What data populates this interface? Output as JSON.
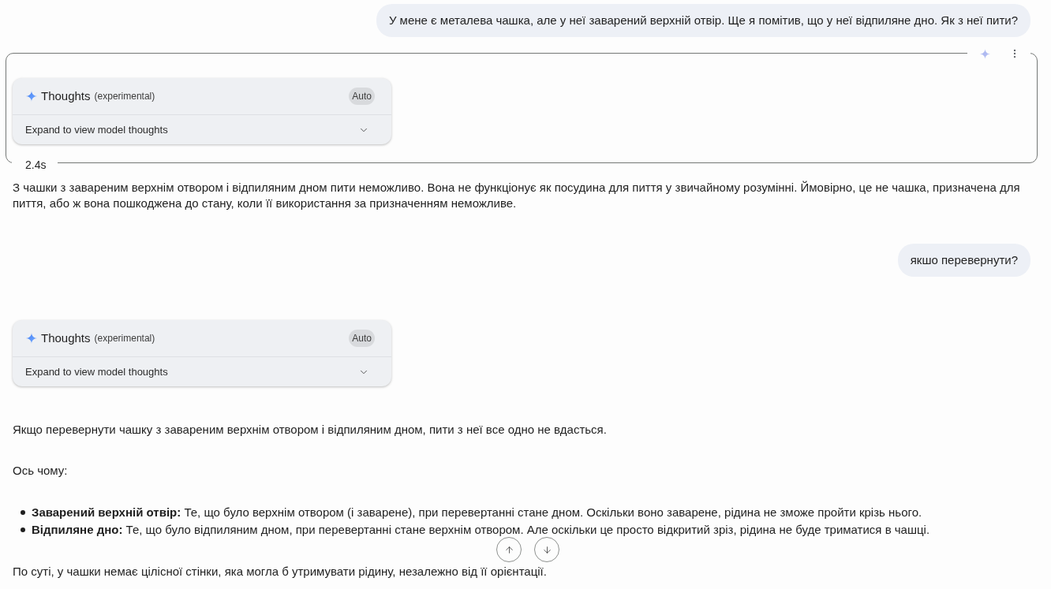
{
  "messages": [
    {
      "kind": "user",
      "text": "У мене є металева чашка, але у неї заварений верхній отвір. Ще я помітив, що у неї відпиляне дно. Як з неї пити?"
    },
    {
      "kind": "model",
      "focused": true,
      "thoughts": {
        "title": "Thoughts",
        "tag": "(experimental)",
        "mode": "Auto",
        "expand_label": "Expand to view model thoughts",
        "expanded": false
      },
      "duration": "2.4s",
      "blocks": [
        {
          "kind": "paragraph",
          "text": "З чашки з завареним верхнім отвором і відпиляним дном пити неможливо. Вона не функціонує як посудина для пиття у звичайному розумінні. Ймовірно, це не чашка, призначена для пиття, або ж вона пошкоджена до стану, коли її використання за призначенням неможливе."
        }
      ]
    },
    {
      "kind": "user",
      "text": "якшо перевернути?"
    },
    {
      "kind": "model",
      "focused": false,
      "thoughts": {
        "title": "Thoughts",
        "tag": "(experimental)",
        "mode": "Auto",
        "expand_label": "Expand to view model thoughts",
        "expanded": false
      },
      "blocks": [
        {
          "kind": "paragraph",
          "text": "Якщо перевернути чашку з завареним верхнім отвором і відпиляним дном, пити з неї все одно не вдасться."
        },
        {
          "kind": "paragraph",
          "text": "Ось чому:"
        },
        {
          "kind": "list",
          "items": [
            "**Заварений верхній отвір:** Те, що було верхнім отвором (і заварене), при перевертанні стане дном. Оскільки воно заварене, рідина не зможе пройти крізь нього.",
            "**Відпиляне дно:** Те, що було відпиляним дном, при перевертанні стане верхнім отвором. Але оскільки це просто відкритий зріз, рідина не буде триматися в чашці."
          ]
        },
        {
          "kind": "paragraph",
          "text": "По суті, у чашки немає цілісної стінки, яка могла б утримувати рідину, незалежно від її орієнтації."
        }
      ]
    }
  ]
}
